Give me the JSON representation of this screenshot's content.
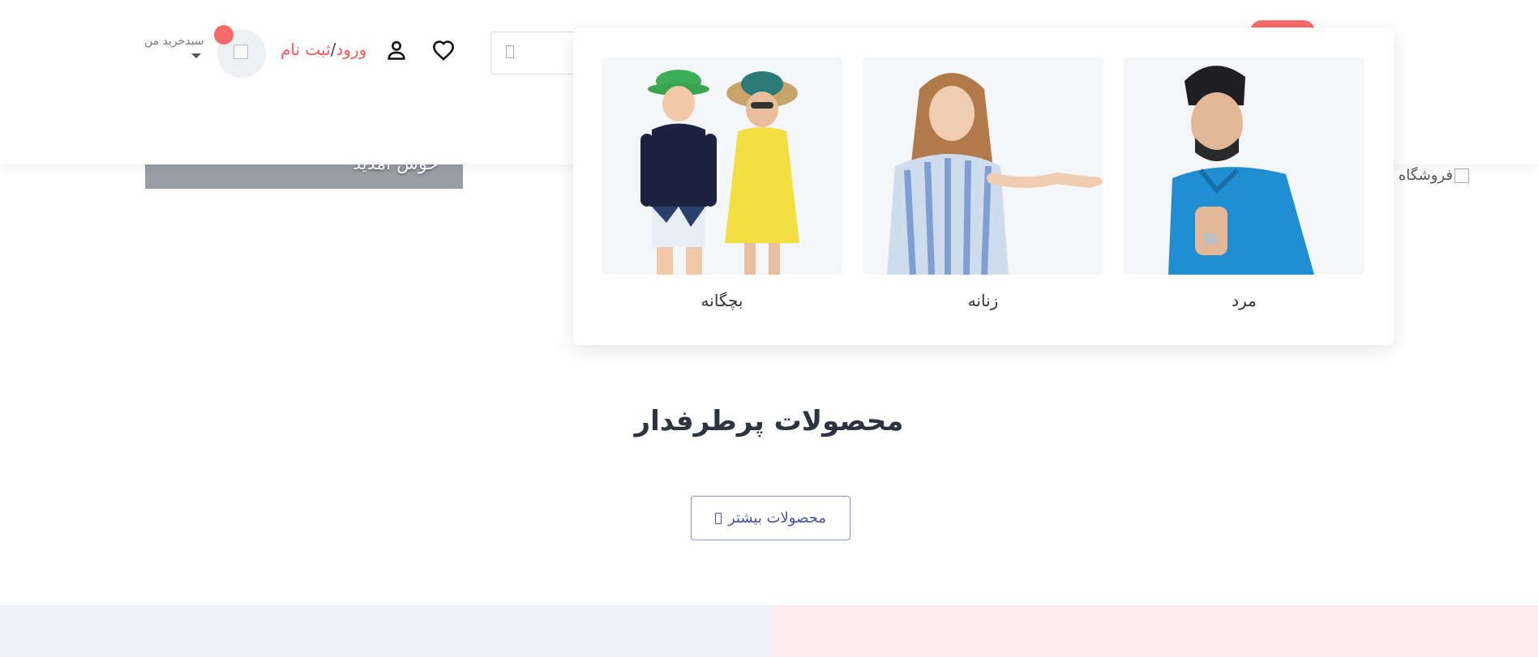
{
  "header": {
    "auth": {
      "login_label": "ورود",
      "separator": "/",
      "register_label": "ثبت نام"
    },
    "cart": {
      "label": "سبدخرید من"
    },
    "accent_color": "#f96b6b"
  },
  "welcome": {
    "text": "خوش آمدید"
  },
  "logo": {
    "alt_text": "فروشگاه ر"
  },
  "megamenu": {
    "categories": [
      {
        "label": "مرد"
      },
      {
        "label": "زنانه"
      },
      {
        "label": "بچگانه"
      }
    ]
  },
  "popular": {
    "title": "محصولات پرطرفدار",
    "more_button_label": "محصولات بیشتر"
  }
}
